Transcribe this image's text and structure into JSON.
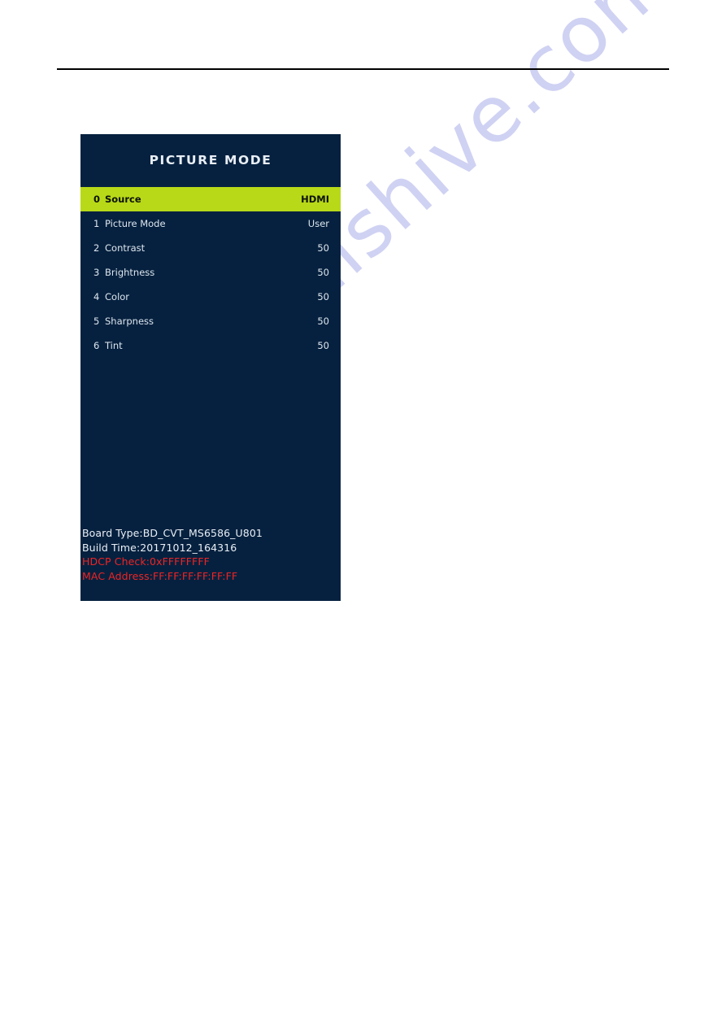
{
  "page": {
    "watermark": "manualshive.com",
    "rule": "horizontal-rule"
  },
  "osd": {
    "title": "PICTURE MODE",
    "theme": {
      "panel_bg": "#06213f",
      "highlight_bg": "#b7d918",
      "text": "#dde6ef",
      "alert_text": "#ee2424"
    },
    "menu": [
      {
        "index": "0",
        "label": "Source",
        "value": "HDMI",
        "selected": true
      },
      {
        "index": "1",
        "label": "Picture Mode",
        "value": "User",
        "selected": false
      },
      {
        "index": "2",
        "label": "Contrast",
        "value": "50",
        "selected": false
      },
      {
        "index": "3",
        "label": "Brightness",
        "value": "50",
        "selected": false
      },
      {
        "index": "4",
        "label": "Color",
        "value": "50",
        "selected": false
      },
      {
        "index": "5",
        "label": "Sharpness",
        "value": "50",
        "selected": false
      },
      {
        "index": "6",
        "label": "Tint",
        "value": "50",
        "selected": false
      }
    ],
    "info": [
      {
        "text": "Board Type:BD_CVT_MS6586_U801",
        "style": "light"
      },
      {
        "text": "Build Time:20171012_164316",
        "style": "light"
      },
      {
        "text": "HDCP Check:0xFFFFFFFF",
        "style": "alert"
      },
      {
        "text": "MAC Address:FF:FF:FF:FF:FF:FF",
        "style": "alert"
      }
    ]
  }
}
